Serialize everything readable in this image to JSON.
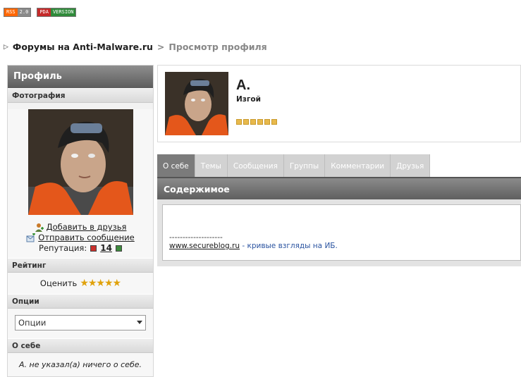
{
  "badges": {
    "rss": {
      "left": "RSS",
      "right": "2.0"
    },
    "pda": {
      "left": "PDA",
      "right": "VERSION"
    }
  },
  "breadcrumb": {
    "forum": "Форумы на Anti-Malware.ru",
    "separator": ">",
    "current": "Просмотр профиля"
  },
  "sidebar": {
    "header": "Профиль",
    "photo_title": "Фотография",
    "add_friend": "Добавить в друзья",
    "send_message": "Отправить сообщение",
    "reputation_label": "Репутация:",
    "reputation_value": "14",
    "rating_title": "Рейтинг",
    "rate_label": "Оценить",
    "stars": "★★★★★",
    "options_title": "Опции",
    "options_selected": "Опции",
    "about_title": "О себе",
    "about_text": "А. не указал(а) ничего о себе."
  },
  "profile": {
    "name": "А.",
    "member_title": "Изгой",
    "pips": 6
  },
  "tabs": [
    "О себе",
    "Темы",
    "Сообщения",
    "Группы",
    "Комментарии",
    "Друзья"
  ],
  "content": {
    "header": "Содержимое",
    "dashes": "--------------------",
    "sig_link": "www.secureblog.ru",
    "sig_text": " - кривые взгляды на ИБ."
  },
  "colors": {
    "header_gray": "#6e6e6e",
    "pip_gold": "#e8b94c",
    "star_gold": "#e0a20c"
  }
}
